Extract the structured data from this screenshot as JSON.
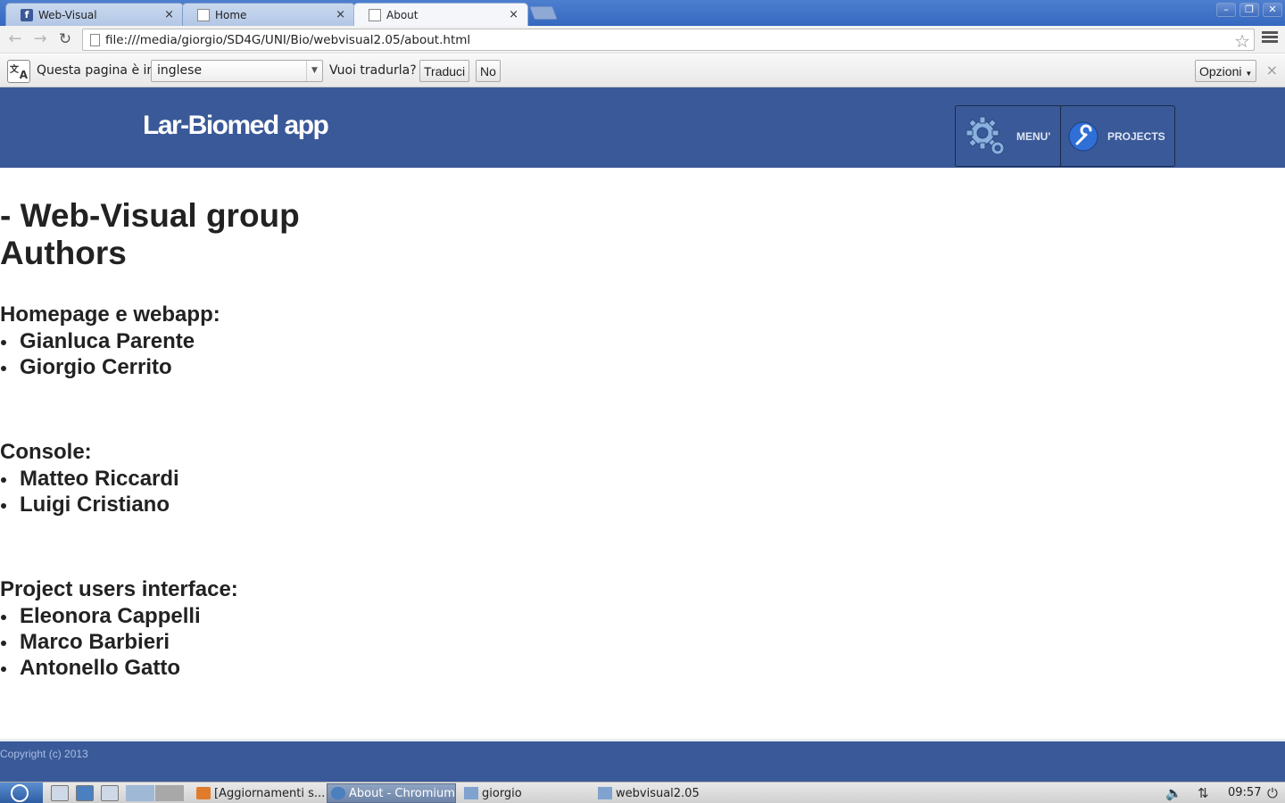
{
  "browser": {
    "tabs": [
      {
        "title": "Web-Visual",
        "icon": "facebook-icon",
        "active": false
      },
      {
        "title": "Home",
        "icon": "page-icon",
        "active": false
      },
      {
        "title": "About",
        "icon": "page-icon",
        "active": true
      }
    ],
    "close_glyph": "×",
    "url": "file:///media/giorgio/SD4G/UNI/Bio/webvisual2.05/about.html"
  },
  "translate_bar": {
    "label_prefix": "Questa pagina è in",
    "language": "inglese",
    "question": "Vuoi tradurla?",
    "translate_button": "Traduci",
    "no_button": "No",
    "options_button": "Opzioni"
  },
  "site": {
    "title": "Lar-Biomed app",
    "nav": {
      "menu_label": "MENU'",
      "projects_label": "PROJECTS"
    },
    "colors": {
      "header": "#3a5998",
      "footer_text": "#a9bde4"
    }
  },
  "content": {
    "heading_line1": "- Web-Visual group",
    "heading_line2": "Authors",
    "sections": [
      {
        "title": "Homepage e webapp:",
        "members": [
          "Gianluca Parente",
          "Giorgio Cerrito"
        ]
      },
      {
        "title": "Console:",
        "members": [
          "Matteo Riccardi",
          "Luigi Cristiano"
        ]
      },
      {
        "title": "Project users interface:",
        "members": [
          "Eleonora Cappelli",
          "Marco Barbieri",
          "Antonello Gatto"
        ]
      }
    ]
  },
  "footer": {
    "copyright": "Copyright (c) 2013"
  },
  "taskbar": {
    "tasks": [
      {
        "label": "[Aggiornamenti s...",
        "active": false
      },
      {
        "label": "About - Chromium",
        "active": true
      },
      {
        "label": "giorgio",
        "active": false
      },
      {
        "label": "webvisual2.05",
        "active": false
      }
    ],
    "clock": "09:57"
  }
}
